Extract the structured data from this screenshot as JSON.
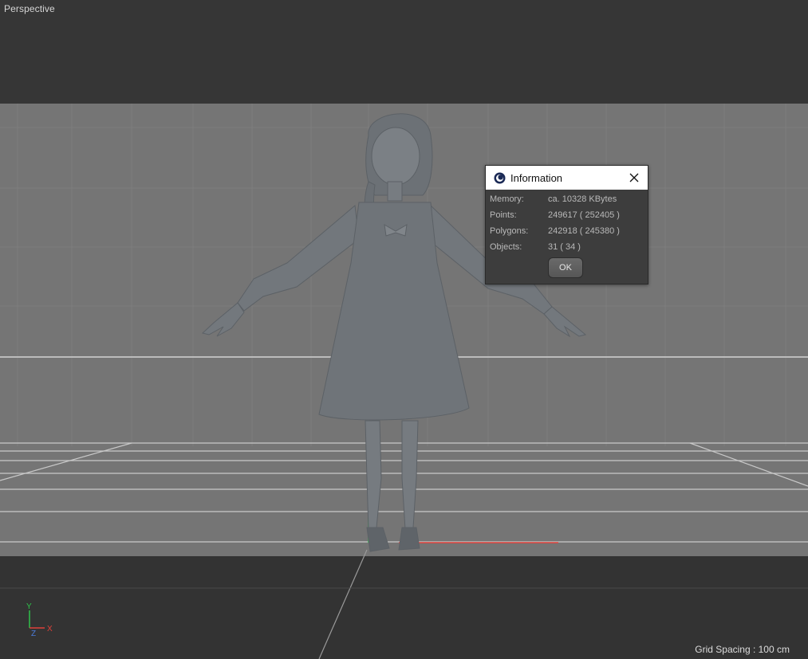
{
  "viewport": {
    "label": "Perspective",
    "grid_spacing_text": "Grid Spacing : 100 cm",
    "axis_labels": {
      "y": "Y",
      "z": "Z",
      "x": "X"
    },
    "colors": {
      "y_axis": "#2ec34a",
      "x_axis": "#e0413a",
      "z_axis": "#4b7bd9",
      "model": "#74797e"
    }
  },
  "dialog": {
    "title": "Information",
    "icon": "cinema4d-logo-icon",
    "close_icon": "close-icon",
    "rows": [
      {
        "label": "Memory:",
        "value": "ca. 10328 KBytes"
      },
      {
        "label": "Points:",
        "value": "249617 ( 252405 )"
      },
      {
        "label": "Polygons:",
        "value": "242918 ( 245380 )"
      },
      {
        "label": "Objects:",
        "value": "31 ( 34 )"
      }
    ],
    "ok_label": "OK"
  }
}
